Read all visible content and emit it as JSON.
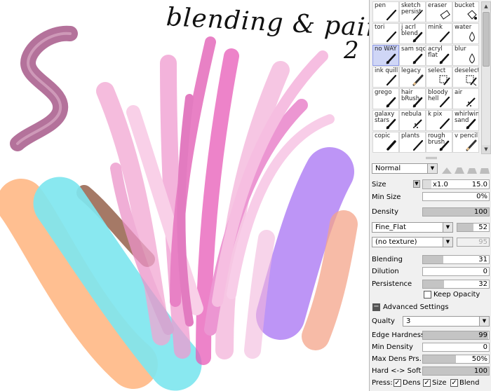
{
  "canvas": {
    "title": "blending & painting",
    "scribble": "2"
  },
  "tools": [
    {
      "label": "pen",
      "icon": "pen-icon"
    },
    {
      "label": "sketch persist",
      "icon": "sketch-pen-icon"
    },
    {
      "label": "eraser",
      "icon": "eraser-icon"
    },
    {
      "label": "bucket",
      "icon": "bucket-icon"
    },
    {
      "label": "tori",
      "icon": "pen-icon"
    },
    {
      "label": "j acrl blend",
      "icon": "brush-icon"
    },
    {
      "label": "mink",
      "icon": "pen-icon"
    },
    {
      "label": "water",
      "icon": "water-drop-icon"
    },
    {
      "label": "no WAY",
      "icon": "brush-icon",
      "selected": true
    },
    {
      "label": "sam sqc",
      "icon": "brush-icon"
    },
    {
      "label": "acryl flat",
      "icon": "brush-icon"
    },
    {
      "label": "blur",
      "icon": "water-drop-icon"
    },
    {
      "label": "ink quill",
      "icon": "pen-icon"
    },
    {
      "label": "legacy",
      "icon": "pencil-icon"
    },
    {
      "label": "select",
      "icon": "selection-pen-icon"
    },
    {
      "label": "deselect",
      "icon": "deselect-pen-icon"
    },
    {
      "label": "grego",
      "icon": "brush-icon"
    },
    {
      "label": "hair bRush",
      "icon": "brush-icon"
    },
    {
      "label": "bloody hell",
      "icon": "pen-icon"
    },
    {
      "label": "air",
      "icon": "airbrush-icon"
    },
    {
      "label": "galaxy stars",
      "icon": "brush-icon"
    },
    {
      "label": "nebula",
      "icon": "airbrush-icon"
    },
    {
      "label": "k pix",
      "icon": "pen-icon"
    },
    {
      "label": "whirlwin sand",
      "icon": "brush-icon"
    },
    {
      "label": "copic",
      "icon": "marker-icon"
    },
    {
      "label": "plants",
      "icon": "pen-icon"
    },
    {
      "label": "rough brush",
      "icon": "brush-icon"
    },
    {
      "label": "v pencil",
      "icon": "pencil-icon"
    }
  ],
  "blend_mode": "Normal",
  "size": {
    "label": "Size",
    "multiplier": "x1.0",
    "value": "15.0"
  },
  "min_size": {
    "label": "Min Size",
    "value": "0%"
  },
  "density": {
    "label": "Density",
    "value": "100",
    "fraction": 1.0
  },
  "brush_shape": {
    "value": "Fine_Flat",
    "amount": "52"
  },
  "texture": {
    "value": "(no texture)",
    "amount": "95"
  },
  "blending": {
    "label": "Blending",
    "value": "31",
    "fraction": 0.31
  },
  "dilution": {
    "label": "Dilution",
    "value": "0",
    "fraction": 0.0
  },
  "persistence": {
    "label": "Persistence",
    "value": "32",
    "fraction": 0.32
  },
  "keep_opacity": {
    "label": "Keep Opacity",
    "checked": false
  },
  "advanced": {
    "label": "Advanced Settings",
    "collapse_symbol": "−"
  },
  "quality": {
    "label": "Qualty",
    "value": "3"
  },
  "edge_hardness": {
    "label": "Edge Hardness",
    "value": "99",
    "fraction": 0.99
  },
  "min_density": {
    "label": "Min Density",
    "value": "0",
    "fraction": 0.0
  },
  "max_dens_prs": {
    "label": "Max Dens Prs.",
    "value": "50%",
    "fraction": 0.5
  },
  "hard_soft": {
    "label": "Hard <-> Soft",
    "value": "100",
    "fraction": 1.0
  },
  "press": {
    "label": "Press:",
    "dens": "Dens",
    "size": "Size",
    "blend": "Blend",
    "check": "✓"
  },
  "colors": {
    "panel_bg": "#f0f0f0",
    "selected_tool": "#cfd6f6",
    "bar_fill": "#c4c4c4"
  }
}
